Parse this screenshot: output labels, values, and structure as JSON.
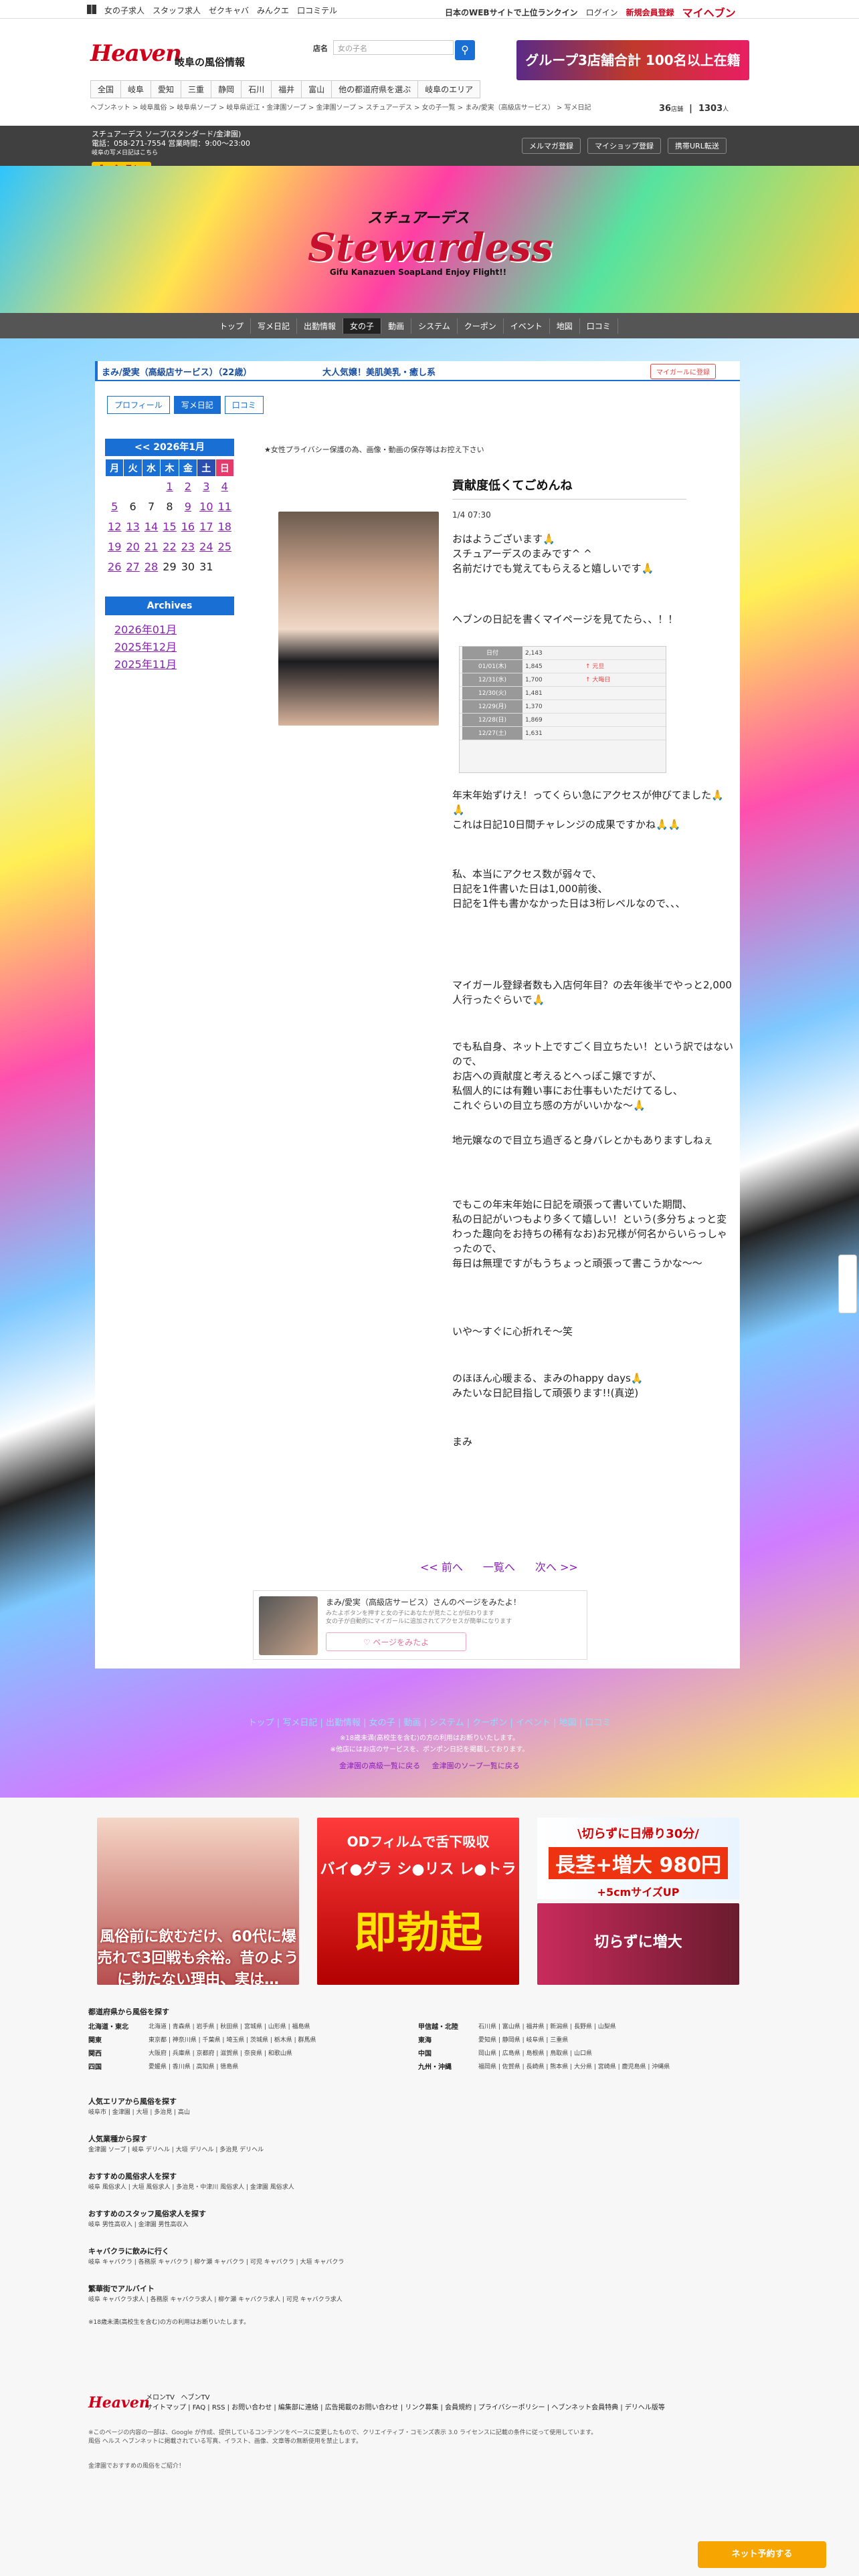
{
  "topbar": {
    "links": [
      "女の子求人",
      "スタッフ求人",
      "ゼクキャバ",
      "みんクエ",
      "口コミテル"
    ],
    "right": [
      "日本のWEBサイトで上位ランクイン",
      "ログイン",
      "新規会員登録"
    ],
    "my": "マイヘブン"
  },
  "header": {
    "logo": "Heaven",
    "region": "岐阜の風俗情報",
    "search_label": "店名",
    "search_placeholder": "女の子名",
    "search_icon": "search-icon",
    "banner": "グループ3店舗合計 100名以上在籍"
  },
  "catnav": [
    "全国",
    "岐阜",
    "愛知",
    "三重",
    "静岡",
    "石川",
    "福井",
    "富山",
    "他の都道府県を選ぶ",
    "岐阜のエリア"
  ],
  "breadcrumb": "ヘブンネット > 岐阜風俗 > 岐阜県ソープ > 岐阜県近江・金津園ソープ > 金津園ソープ > スチュアーデス > 女の子一覧 > まみ/愛実（高級店サービス） > 写メ日記",
  "counter": {
    "a": "36",
    "a_unit": "店舗",
    "b": "1303",
    "b_unit": "人"
  },
  "shop": {
    "line1": "スチュアーデス ソープ(スタンダード/金津園)",
    "line2": "電話：058-271-7554 営業時間：9:00～23:00",
    "line3": "岐阜の写メ日記はこちら",
    "hvn": "「ヘブン見た」",
    "links": [
      "メルマガ登録",
      "マイショップ登録",
      "携帯URL転送"
    ]
  },
  "hero": {
    "small": "スチュアーデス",
    "big": "Stewardess",
    "sub": "Gifu Kanazuen  SoapLand  Enjoy Flight!!"
  },
  "shopnav": [
    "トップ",
    "写メ日記",
    "出勤情報",
    "女の子",
    "動画",
    "システム",
    "クーポン",
    "イベント",
    "地図",
    "口コミ"
  ],
  "girl": {
    "name": "まみ/愛実（高級店サービス）（22歳）",
    "tag": "大人気嬢！美肌美乳・癒し系",
    "fav": "マイガールに登録"
  },
  "tabs": [
    "プロフィール",
    "写メ日記",
    "口コミ"
  ],
  "calendar": {
    "title": "<< 2026年1月",
    "days": [
      "月",
      "火",
      "水",
      "木",
      "金",
      "土",
      "日"
    ],
    "rows": [
      [
        "",
        "",
        "",
        "1",
        "2",
        "3",
        "4"
      ],
      [
        "5",
        "6",
        "7",
        "8",
        "9",
        "10",
        "11"
      ],
      [
        "12",
        "13",
        "14",
        "15",
        "16",
        "17",
        "18"
      ],
      [
        "19",
        "20",
        "21",
        "22",
        "23",
        "24",
        "25"
      ],
      [
        "26",
        "27",
        "28",
        "29",
        "30",
        "31",
        ""
      ]
    ],
    "linked": [
      "1",
      "2",
      "3",
      "4",
      "5",
      "9",
      "10",
      "11",
      "12",
      "13",
      "14",
      "15",
      "16",
      "17",
      "18",
      "19",
      "20",
      "21",
      "22",
      "23",
      "24",
      "25",
      "26",
      "27",
      "28"
    ]
  },
  "archives": {
    "title": "Archives",
    "items": [
      "2026年01月",
      "2025年12月",
      "2025年11月"
    ]
  },
  "privacy": "★女性プライバシー保護の為、画像・動画の保存等はお控え下さい",
  "post": {
    "title": "貢献度低くてごめんね",
    "date": "1/4 07:30",
    "p1": "おはようございます🙏\nスチュアーデスのまみです^ ^\n名前だけでも覚えてもらえると嬉しいです🙏",
    "p2": "ヘブンの日記を書くマイページを見てたら、、！！",
    "p3": "年末年始ずけえ！ってくらい急にアクセスが伸びてました🙏🙏\nこれは日記10日間チャレンジの成果ですかね🙏🙏",
    "p4": "私、本当にアクセス数が弱々で、\n日記を1件書いた日は1,000前後、\n日記を1件も書かなかった日は3桁レベルなので、、、",
    "p5": "マイガール登録者数も入店何年目？の去年後半でやっと2,000人行ったぐらいで🙏",
    "p6": "でも私自身、ネット上ですごく目立ちたい！という訳ではないので、\nお店への貢献度と考えるとへっぽこ嬢ですが、\n私個人的には有難い事にお仕事もいただけてるし、\nこれぐらいの目立ち感の方がいいかな〜🙏",
    "p7": "地元嬢なので目立ち過ぎると身バレとかもありますしねぇ",
    "p8": "でもこの年末年始に日記を頑張って書いていた期間、\n私の日記がいつもより多くて嬉しい！という(多分ちょっと変わった趣向をお持ちの稀有なお)お兄様が何名からいらっしゃったので、\n毎日は無理ですがもうちょっと頑張って書こうかな〜〜",
    "p9": "いや〜すぐに心折れそ〜笑",
    "p10": "のほほん心暖まる、まみのhappy days🙏\nみたいな日記目指して頑張ります!!(真逆)",
    "p11": "まみ",
    "access": [
      [
        "日付",
        "2,143",
        ""
      ],
      [
        "01/01(木)",
        "1,845",
        "↑ 元旦"
      ],
      [
        "12/31(水)",
        "1,700",
        "↑ 大晦日"
      ],
      [
        "12/30(火)",
        "1,481",
        ""
      ],
      [
        "12/29(月)",
        "1,370",
        ""
      ],
      [
        "12/28(日)",
        "1,869",
        ""
      ],
      [
        "12/27(土)",
        "1,631",
        ""
      ]
    ]
  },
  "pager": {
    "prev": "<< 前へ",
    "list": "一覧へ",
    "next": "次へ >>"
  },
  "girlcard": {
    "title": "まみ/愛実（高級店サービス）さんのページをみたよ！",
    "sub": "みたよボタンを押すと女の子にあなたが見たことが伝わります\n女の子が自動的にマイガールに追加されてアクセスが簡単になります",
    "btn": "♡ ページをみたよ"
  },
  "footnav": {
    "links": [
      "トップ",
      "写メ日記",
      "出勤情報",
      "女の子",
      "動画",
      "システム",
      "クーポン",
      "イベント",
      "地図",
      "口コミ"
    ],
    "n1": "※18歳未満(高校生を含む)の方の利用はお断りいたします。",
    "n2": "※他店にはお店のサービスを、ポンポン日記を掲載しております。",
    "r1": "金津園の高級一覧に戻る",
    "r2": "金津園のソープ一覧に戻る"
  },
  "ads": {
    "ad1": "風俗前に飲むだけ、60代に爆売れで3回戦も余裕。昔のように勃たない理由、実は…",
    "ad2_top": "ODフィルムで舌下吸収",
    "ad2_mid": "バイ●グラ シ●リス レ●トラ",
    "ad2_big": "即勃起",
    "ad3_top": "\\切らずに日帰り30分/",
    "ad3_num": "長茎+増大 980円",
    "ad3_sub": "+5cmサイズUP",
    "ad4": "切らずに増大"
  },
  "sitemap": {
    "h1": "都道府県から風俗を探す",
    "regions_l": [
      [
        "北海道・東北",
        "北海道 | 青森県 | 岩手県 | 秋田県 | 宮城県 | 山形県 | 福島県"
      ],
      [
        "関東",
        "東京都 | 神奈川県 | 千葉県 | 埼玉県 | 茨城県 | 栃木県 | 群馬県"
      ],
      [
        "関西",
        "大阪府 | 兵庫県 | 京都府 | 滋賀県 | 奈良県 | 和歌山県"
      ],
      [
        "四国",
        "愛媛県 | 香川県 | 高知県 | 徳島県"
      ]
    ],
    "regions_r": [
      [
        "甲信越・北陸",
        "石川県 | 富山県 | 福井県 | 新潟県 | 長野県 | 山梨県"
      ],
      [
        "東海",
        "愛知県 | 静岡県 | 岐阜県 | 三重県"
      ],
      [
        "中国",
        "岡山県 | 広島県 | 島根県 | 鳥取県 | 山口県"
      ],
      [
        "九州・沖縄",
        "福岡県 | 佐賀県 | 長崎県 | 熊本県 | 大分県 | 宮崎県 | 鹿児島県 | 沖縄県"
      ]
    ],
    "h2": "人気エリアから風俗を探す",
    "l2": "岐阜市 | 金津園 | 大垣 | 多治見 | 高山",
    "h3": "人気業種から探す",
    "l3": "金津園 ソープ | 岐阜 デリヘル | 大垣 デリヘル | 多治見 デリヘル",
    "h4": "おすすめの風俗求人を探す",
    "l4": "岐阜 風俗求人 | 大垣 風俗求人 | 多治見・中津川 風俗求人 | 金津園 風俗求人",
    "h5": "おすすめのスタッフ風俗求人を探す",
    "l5": "岐阜 男性高収入 | 金津園 男性高収入",
    "h6": "キャバクラに飲みに行く",
    "l6": "岐阜 キャバクラ | 各務原 キャバクラ | 柳ケ瀬 キャバクラ | 可児 キャバクラ | 大垣 キャバクラ",
    "h7": "繁華街でアルバイト",
    "l7": "岐阜 キャバクラ求人 | 各務原 キャバクラ求人 | 柳ケ瀬 キャバクラ求人 | 可児 キャバクラ求人",
    "n": "※18歳未満(高校生を含む)の方の利用はお断りいたします。"
  },
  "footer": {
    "logo": "Heaven",
    "links": "メロンTV   ヘブンTV\nサイトマップ | FAQ | RSS | お問い合わせ | 編集部に連絡 | 広告掲載のお問い合わせ | リンク募集 | 会員規約 | プライバシーポリシー | ヘブンネット会員特典 | デリヘル版等",
    "note": "※このページの内容の一部は、Google が作成、提供しているコンテンツをベースに変更したもので、クリエイティブ・コモンズ表示 3.0 ライセンスに記載の条件に従って使用しています。\n風俗 ヘルス ヘブンネットに掲載されている写真、イラスト、画像、文章等の無断使用を禁止します。",
    "copy": "金津園でおすすめの風俗をご紹介！",
    "float": "ネット予約する"
  }
}
